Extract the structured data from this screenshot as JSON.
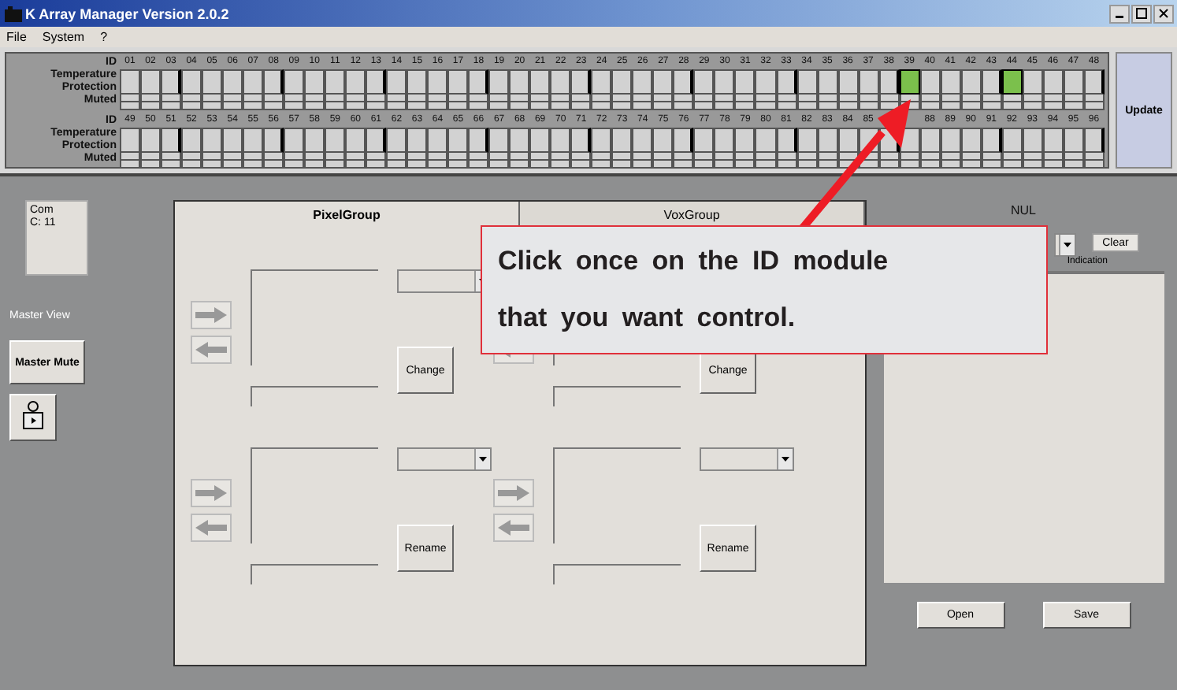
{
  "window": {
    "title": "K Array Manager Version 2.0.2"
  },
  "menu": [
    "File",
    "System",
    "?"
  ],
  "grid": {
    "blocks": [
      {
        "row_labels": [
          "ID",
          "Temperature",
          "Protection",
          "Muted"
        ],
        "modules": [
          {
            "id": "01",
            "selected": false
          },
          {
            "id": "02",
            "selected": false
          },
          {
            "id": "03",
            "selected": false
          },
          {
            "id": "04",
            "selected": false
          },
          {
            "id": "05",
            "selected": false
          },
          {
            "id": "06",
            "selected": false
          },
          {
            "id": "07",
            "selected": false
          },
          {
            "id": "08",
            "selected": false
          },
          {
            "id": "09",
            "selected": false
          },
          {
            "id": "10",
            "selected": false
          },
          {
            "id": "11",
            "selected": false
          },
          {
            "id": "12",
            "selected": false
          },
          {
            "id": "13",
            "selected": false
          },
          {
            "id": "14",
            "selected": false
          },
          {
            "id": "15",
            "selected": false
          },
          {
            "id": "16",
            "selected": false
          },
          {
            "id": "17",
            "selected": false
          },
          {
            "id": "18",
            "selected": false
          },
          {
            "id": "19",
            "selected": false
          },
          {
            "id": "20",
            "selected": false
          },
          {
            "id": "21",
            "selected": false
          },
          {
            "id": "22",
            "selected": false
          },
          {
            "id": "23",
            "selected": false
          },
          {
            "id": "24",
            "selected": false
          },
          {
            "id": "25",
            "selected": false
          },
          {
            "id": "26",
            "selected": false
          },
          {
            "id": "27",
            "selected": false
          },
          {
            "id": "28",
            "selected": false
          },
          {
            "id": "29",
            "selected": false
          },
          {
            "id": "30",
            "selected": false
          },
          {
            "id": "31",
            "selected": false
          },
          {
            "id": "32",
            "selected": false
          },
          {
            "id": "33",
            "selected": false
          },
          {
            "id": "34",
            "selected": false
          },
          {
            "id": "35",
            "selected": false
          },
          {
            "id": "36",
            "selected": false
          },
          {
            "id": "37",
            "selected": false
          },
          {
            "id": "38",
            "selected": false
          },
          {
            "id": "39",
            "selected": true
          },
          {
            "id": "40",
            "selected": false
          },
          {
            "id": "41",
            "selected": false
          },
          {
            "id": "42",
            "selected": false
          },
          {
            "id": "43",
            "selected": false
          },
          {
            "id": "44",
            "selected": true
          },
          {
            "id": "45",
            "selected": false
          },
          {
            "id": "46",
            "selected": false
          },
          {
            "id": "47",
            "selected": false
          },
          {
            "id": "48",
            "selected": false
          }
        ]
      },
      {
        "row_labels": [
          "ID",
          "Temperature",
          "Protection",
          "Muted"
        ],
        "modules": [
          {
            "id": "49",
            "selected": false
          },
          {
            "id": "50",
            "selected": false
          },
          {
            "id": "51",
            "selected": false
          },
          {
            "id": "52",
            "selected": false
          },
          {
            "id": "53",
            "selected": false
          },
          {
            "id": "54",
            "selected": false
          },
          {
            "id": "55",
            "selected": false
          },
          {
            "id": "56",
            "selected": false
          },
          {
            "id": "57",
            "selected": false
          },
          {
            "id": "58",
            "selected": false
          },
          {
            "id": "59",
            "selected": false
          },
          {
            "id": "60",
            "selected": false
          },
          {
            "id": "61",
            "selected": false
          },
          {
            "id": "62",
            "selected": false
          },
          {
            "id": "63",
            "selected": false
          },
          {
            "id": "64",
            "selected": false
          },
          {
            "id": "65",
            "selected": false
          },
          {
            "id": "66",
            "selected": false
          },
          {
            "id": "67",
            "selected": false
          },
          {
            "id": "68",
            "selected": false
          },
          {
            "id": "69",
            "selected": false
          },
          {
            "id": "70",
            "selected": false
          },
          {
            "id": "71",
            "selected": false
          },
          {
            "id": "72",
            "selected": false
          },
          {
            "id": "73",
            "selected": false
          },
          {
            "id": "74",
            "selected": false
          },
          {
            "id": "75",
            "selected": false
          },
          {
            "id": "76",
            "selected": false
          },
          {
            "id": "77",
            "selected": false
          },
          {
            "id": "78",
            "selected": false
          },
          {
            "id": "79",
            "selected": false
          },
          {
            "id": "80",
            "selected": false
          },
          {
            "id": "81",
            "selected": false
          },
          {
            "id": "82",
            "selected": false
          },
          {
            "id": "83",
            "selected": false
          },
          {
            "id": "84",
            "selected": false
          },
          {
            "id": "85",
            "selected": false
          },
          {
            "selected": false
          },
          {
            "selected": false
          },
          {
            "id": "88",
            "selected": false
          },
          {
            "id": "89",
            "selected": false
          },
          {
            "id": "90",
            "selected": false
          },
          {
            "id": "91",
            "selected": false
          },
          {
            "id": "92",
            "selected": false
          },
          {
            "id": "93",
            "selected": false
          },
          {
            "id": "94",
            "selected": false
          },
          {
            "id": "95",
            "selected": false
          },
          {
            "id": "96",
            "selected": false
          }
        ]
      }
    ]
  },
  "update_button": "Update",
  "port_box": {
    "lines": [
      "Com",
      "C: 11"
    ]
  },
  "master_view_label": "Master View",
  "master_mute_button": "Master Mute",
  "tabs": [
    {
      "label": "PixelGroup",
      "selected": true
    },
    {
      "label": "VoxGroup",
      "selected": false
    }
  ],
  "sections": [
    {
      "button": "Change"
    },
    {
      "button": "Change"
    },
    {
      "button": "Rename"
    },
    {
      "button": "Rename"
    }
  ],
  "right_panel": {
    "title": "NUL",
    "clear_button": "Clear",
    "status_label": "Indication",
    "buttons": [
      "Open",
      "Save"
    ]
  },
  "callout": {
    "lines": [
      "Click once on the ID module",
      "that you want control."
    ]
  }
}
